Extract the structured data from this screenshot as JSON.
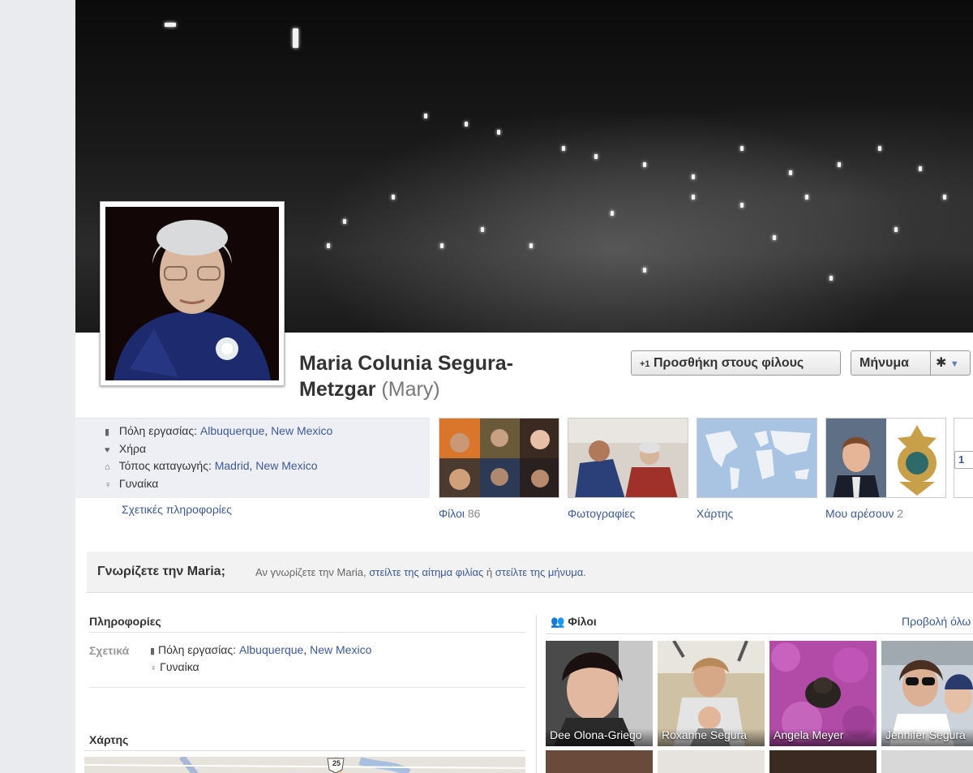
{
  "profile": {
    "name": "Maria Colunia Segura-Metzgar",
    "alt_name": "(Mary)"
  },
  "actions": {
    "add_friend": "Προσθήκη στους φίλους",
    "add_friend_icon": "+1",
    "message": "Μήνυμα",
    "settings_icon": "gear-icon"
  },
  "summary": {
    "work_label": "Πόλη εργασίας:",
    "work_city": "Albuquerque",
    "work_state": "New Mexico",
    "relationship": "Χήρα",
    "hometown_label": "Τόπος καταγωγής:",
    "hometown_city": "Madrid",
    "hometown_state": "New Mexico",
    "gender": "Γυναίκα",
    "about_link": "Σχετικές πληροφορίες"
  },
  "tabs": {
    "friends_label": "Φίλοι",
    "friends_count": "86",
    "photos_label": "Φωτογραφίες",
    "map_label": "Χάρτης",
    "likes_label": "Μου αρέσουν",
    "likes_count": "2",
    "more_label": "1"
  },
  "know": {
    "question": "Γνωρίζετε την Maria;",
    "text_prefix": "Αν γνωρίζετε την Maria,",
    "link_request": "στείλτε της αίτημα φιλίας",
    "text_or": "ή",
    "link_message": "στείλτε της μήνυμα",
    "text_end": "."
  },
  "info_section": {
    "title": "Πληροφορίες",
    "about_label": "Σχετικά",
    "work_label": "Πόλη εργασίας:",
    "work_city": "Albuquerque",
    "work_state": "New Mexico",
    "gender": "Γυναίκα",
    "map_title": "Χάρτης",
    "highway": "25"
  },
  "friends_section": {
    "title": "Φίλοι",
    "see_all": "Προβολή όλω",
    "friends": [
      {
        "name": "Dee Olona-Griego"
      },
      {
        "name": "Roxanne Segura"
      },
      {
        "name": "Angela Meyer"
      },
      {
        "name": "Jennifer Segura"
      }
    ]
  },
  "colors": {
    "link": "#3b5998",
    "info_bg": "#edeff4",
    "page_bg": "#e9ebee"
  }
}
